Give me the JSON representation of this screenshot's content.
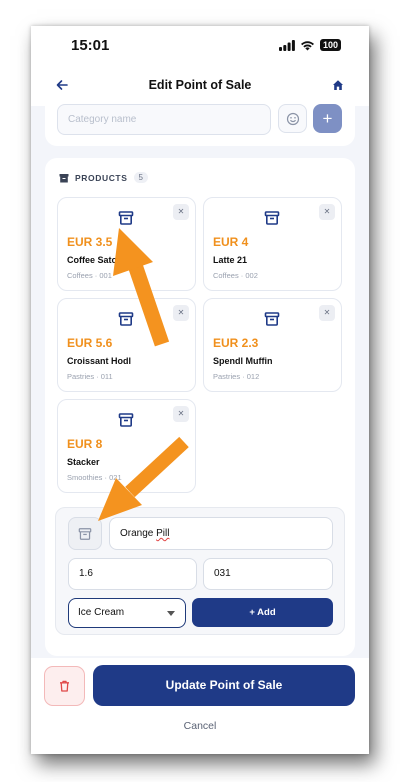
{
  "status_bar": {
    "time": "15:01",
    "battery": "100"
  },
  "nav": {
    "title": "Edit Point of Sale"
  },
  "category_form": {
    "placeholder": "Category name",
    "add_label": "+"
  },
  "products_section": {
    "title": "PRODUCTS",
    "count": "5"
  },
  "products": [
    {
      "price": "EUR 3.5",
      "name": "Coffee Satoshi",
      "meta": "Coffees · 001"
    },
    {
      "price": "EUR 4",
      "name": "Latte 21",
      "meta": "Coffees · 002"
    },
    {
      "price": "EUR 5.6",
      "name": "Croissant Hodl",
      "meta": "Pastries · 011"
    },
    {
      "price": "EUR 2.3",
      "name": "Spendl Muffin",
      "meta": "Pastries · 012"
    },
    {
      "price": "EUR 8",
      "name": "Stacker",
      "meta": "Smoothies · 021"
    }
  ],
  "product_form": {
    "name_prefix": "Orange ",
    "name_underlined": "Pill",
    "price": "1.6",
    "code": "031",
    "category": "Ice Cream",
    "add_label": "+ Add"
  },
  "footer": {
    "update_label": "Update Point of Sale",
    "cancel_label": "Cancel"
  },
  "colors": {
    "brand": "#1f3a87",
    "price": "#f0901d",
    "arrow": "#f4931f",
    "danger": "#e04848"
  },
  "icons": [
    "back-arrow-icon",
    "home-icon",
    "emoji-icon",
    "archive-box-icon",
    "close-icon",
    "trash-icon",
    "signal-icon",
    "wifi-icon"
  ]
}
